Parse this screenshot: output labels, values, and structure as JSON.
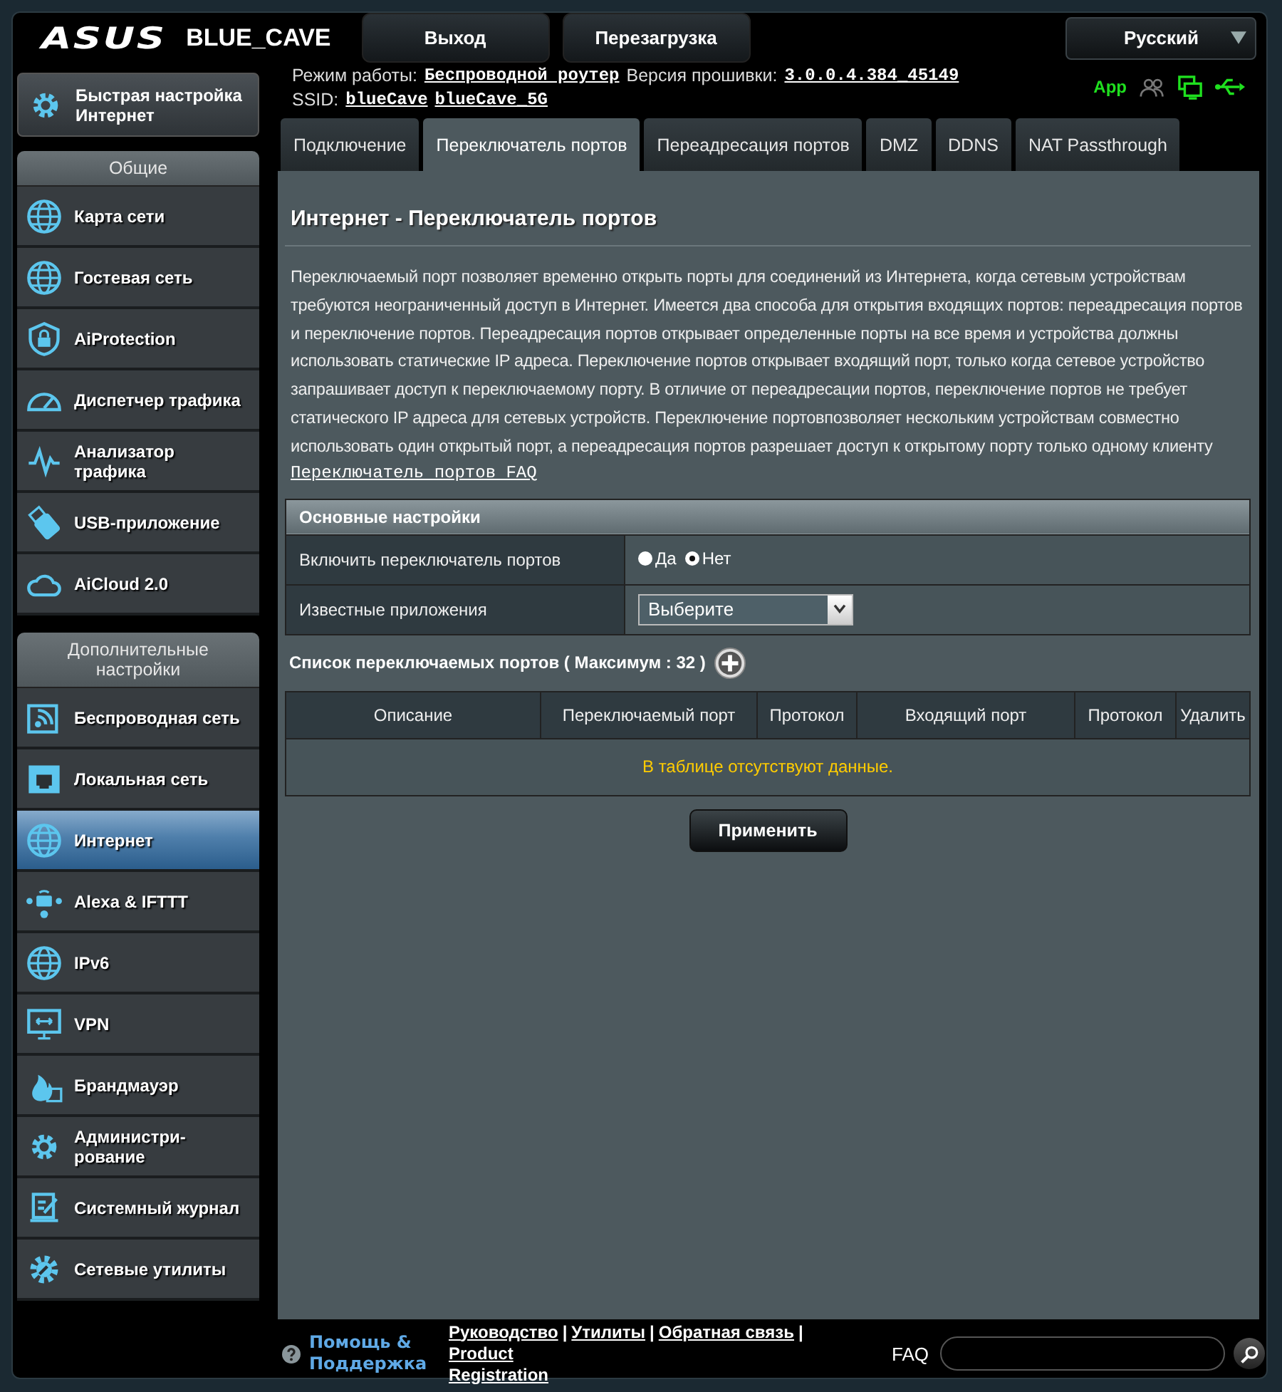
{
  "header": {
    "logo": "ASUS",
    "model": "BLUE_CAVE",
    "buttons": [
      "Выход",
      "Перезагрузка"
    ],
    "language": "Русский"
  },
  "status": {
    "mode_label": "Режим работы:",
    "mode": "Беспроводной роутер",
    "firmware_label": "Версия прошивки:",
    "firmware": "3.0.0.4.384_45149",
    "ssid_label": "SSID:",
    "ssids": [
      "blueCave",
      "blueCave_5G"
    ],
    "app": "App"
  },
  "sidebar": {
    "quick_setup": "Быстрая настройка\nИнтернет",
    "sections": [
      {
        "title": "Общие",
        "items": [
          {
            "label": "Карта сети",
            "selected": false
          },
          {
            "label": "Гостевая сеть",
            "selected": false
          },
          {
            "label": "AiProtection",
            "selected": false
          },
          {
            "label": "Диспетчер трафика",
            "selected": false
          },
          {
            "label": "Анализатор\nтрафика",
            "selected": false
          },
          {
            "label": "USB-приложение",
            "selected": false
          },
          {
            "label": "AiCloud 2.0",
            "selected": false
          }
        ]
      },
      {
        "title": "Дополнительные\nнастройки",
        "items": [
          {
            "label": "Беспроводная сеть",
            "selected": false
          },
          {
            "label": "Локальная сеть",
            "selected": false
          },
          {
            "label": "Интернет",
            "selected": true
          },
          {
            "label": "Alexa & IFTTT",
            "selected": false
          },
          {
            "label": "IPv6",
            "selected": false
          },
          {
            "label": "VPN",
            "selected": false
          },
          {
            "label": "Брандмауэр",
            "selected": false
          },
          {
            "label": "Администри-\nрование",
            "selected": false
          },
          {
            "label": "Системный журнал",
            "selected": false
          },
          {
            "label": "Сетевые утилиты",
            "selected": false
          }
        ]
      }
    ]
  },
  "tabs": [
    {
      "label": "Подключение",
      "selected": false
    },
    {
      "label": "Переключатель портов",
      "selected": true
    },
    {
      "label": "Переадресация портов",
      "selected": false
    },
    {
      "label": "DMZ",
      "selected": false
    },
    {
      "label": "DDNS",
      "selected": false
    },
    {
      "label": "NAT Passthrough",
      "selected": false
    }
  ],
  "page": {
    "title": "Интернет - Переключатель портов",
    "description": "Переключаемый порт позволяет временно открыть порты для соединений из Интернета, когда сетевым устройствам требуются неограниченный доступ в Интернет. Имеется два способа для открытия входящих портов: переадресация портов и переключение портов. Переадресация портов открывает определенные порты на все время и устройства должны использовать статические IP адреса. Переключение портов открывает входящий порт, только когда сетевое устройство запрашивает доступ к переключаемому порту. В отличие от переадресации портов, переключение портов не требует статического IP адреса для сетевых устройств. Переключение портовпозволяет нескольким устройствам совместно использовать один открытый порт, а переадресация портов разрешает доступ к открытому порту только одному клиенту",
    "faq_link": "Переключатель портов FAQ",
    "settings": {
      "title": "Основные настройки",
      "rows": [
        {
          "kind": "radio",
          "label": "Включить переключатель портов",
          "options": [
            {
              "label": "Да",
              "selected": false
            },
            {
              "label": "Нет",
              "selected": true
            }
          ]
        },
        {
          "kind": "select",
          "label": "Известные приложения",
          "value": "Выберите"
        }
      ]
    },
    "list_title": "Список переключаемых портов ( Максимум : 32 )",
    "table": {
      "columns": [
        "Описание",
        "Переключаемый порт",
        "Протокол",
        "Входящий порт",
        "Протокол",
        "Удалить"
      ],
      "empty_message": "В таблице отсутствуют данные."
    },
    "apply": "Применить"
  },
  "footer": {
    "help": "Помощь &\nПоддержка",
    "links": [
      "Руководство",
      "Утилиты",
      "Обратная связь",
      "Product\nRegistration"
    ],
    "separator": "|",
    "faq": "FAQ"
  }
}
